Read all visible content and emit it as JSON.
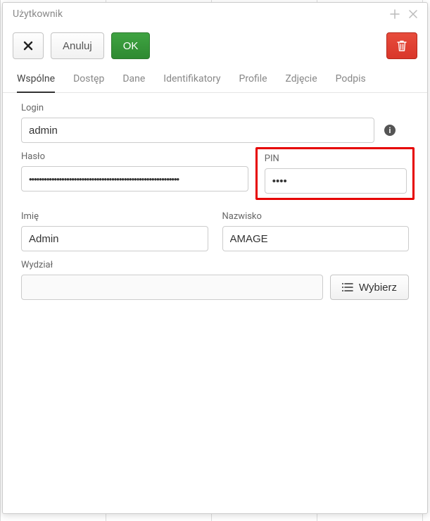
{
  "header": {
    "title": "Użytkownik"
  },
  "toolbar": {
    "cancel_label": "Anuluj",
    "ok_label": "OK"
  },
  "tabs": [
    {
      "label": "Wspólne",
      "active": true
    },
    {
      "label": "Dostęp",
      "active": false
    },
    {
      "label": "Dane",
      "active": false
    },
    {
      "label": "Identifikatory",
      "active": false
    },
    {
      "label": "Profile",
      "active": false
    },
    {
      "label": "Zdjęcie",
      "active": false
    },
    {
      "label": "Podpis",
      "active": false
    }
  ],
  "form": {
    "login": {
      "label": "Login",
      "value": "admin"
    },
    "password": {
      "label": "Hasło",
      "value": "••••••••••••••••••••••••••••••••••••••••••••••••••••••••••••"
    },
    "pin": {
      "label": "PIN",
      "value": "••••"
    },
    "firstname": {
      "label": "Imię",
      "value": "Admin"
    },
    "lastname": {
      "label": "Nazwisko",
      "value": "AMAGE"
    },
    "department": {
      "label": "Wydział",
      "value": ""
    },
    "pick_label": "Wybierz"
  }
}
